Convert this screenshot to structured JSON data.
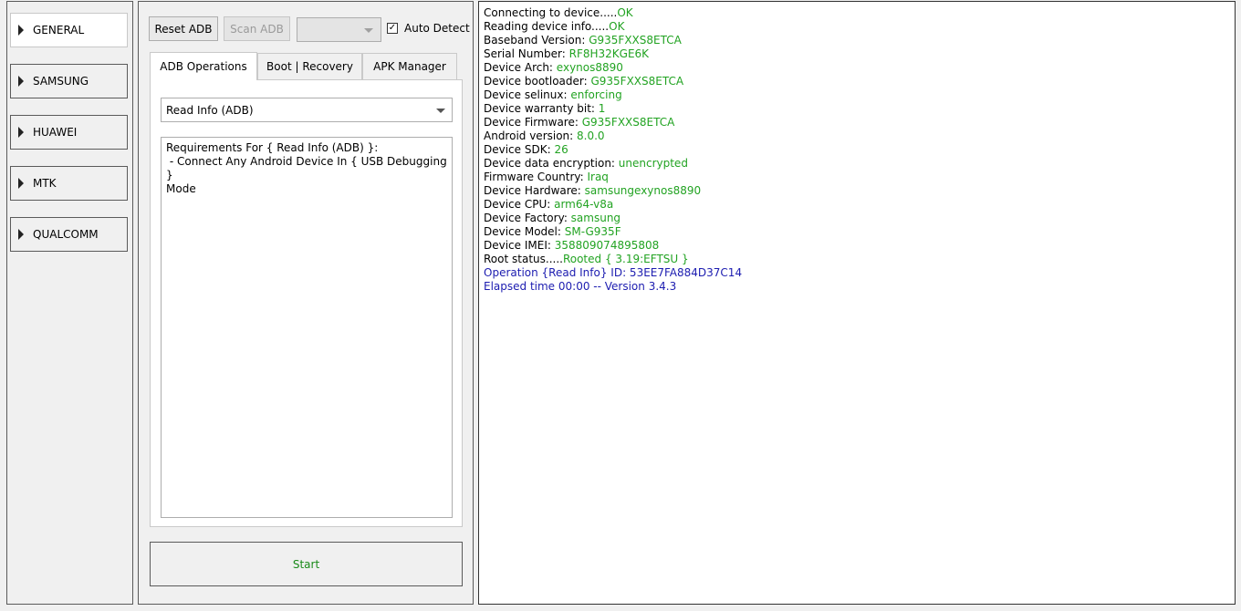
{
  "sidebar": {
    "items": [
      {
        "label": "GENERAL",
        "active": true
      },
      {
        "label": "SAMSUNG",
        "active": false
      },
      {
        "label": "HUAWEI",
        "active": false
      },
      {
        "label": "MTK",
        "active": false
      },
      {
        "label": "QUALCOMM",
        "active": false
      }
    ]
  },
  "toolbar": {
    "reset_adb": "Reset ADB",
    "scan_adb": "Scan ADB",
    "port_select_value": "",
    "auto_detect_label": "Auto Detect",
    "auto_detect_checked": true
  },
  "tabs": [
    {
      "label": "ADB Operations",
      "active": true
    },
    {
      "label": "Boot | Recovery",
      "active": false
    },
    {
      "label": "APK Manager",
      "active": false
    }
  ],
  "operation": {
    "selected": "Read Info (ADB)",
    "requirements": "Requirements For { Read Info (ADB) }:\n - Connect Any Android Device In { USB Debugging }\nMode"
  },
  "start_label": "Start",
  "colors": {
    "value": "#22a322",
    "info": "#1c1cb0",
    "start": "#1a8a1a"
  },
  "log": [
    {
      "label": "Connecting to device.....",
      "value": "OK"
    },
    {
      "label": "Reading device info.....",
      "value": "OK"
    },
    {
      "label": "Baseband Version: ",
      "value": "G935FXXS8ETCA"
    },
    {
      "label": "Serial Number: ",
      "value": "RF8H32KGE6K"
    },
    {
      "label": "Device Arch: ",
      "value": "exynos8890"
    },
    {
      "label": "Device bootloader: ",
      "value": "G935FXXS8ETCA"
    },
    {
      "label": "Device selinux: ",
      "value": "enforcing"
    },
    {
      "label": "Device warranty bit: ",
      "value": "1"
    },
    {
      "label": "Device Firmware: ",
      "value": "G935FXXS8ETCA"
    },
    {
      "label": "Android version: ",
      "value": "8.0.0"
    },
    {
      "label": "Device SDK: ",
      "value": "26"
    },
    {
      "label": "Device data encryption: ",
      "value": "unencrypted"
    },
    {
      "label": "Firmware Country: ",
      "value": "Iraq"
    },
    {
      "label": "Device Hardware: ",
      "value": "samsungexynos8890"
    },
    {
      "label": "Device CPU: ",
      "value": "arm64-v8a"
    },
    {
      "label": "Device Factory: ",
      "value": "samsung"
    },
    {
      "label": "Device Model: ",
      "value": "SM-G935F"
    },
    {
      "label": "Device IMEI: ",
      "value": "358809074895808"
    },
    {
      "label": "Root status.....",
      "value": "Rooted { 3.19:EFTSU }"
    },
    {
      "label": "Operation {Read Info} ID: 53EE7FA884D37C14",
      "value": "",
      "blue": true
    },
    {
      "label": "Elapsed time 00:00 -- Version 3.4.3",
      "value": "",
      "blue": true
    }
  ]
}
